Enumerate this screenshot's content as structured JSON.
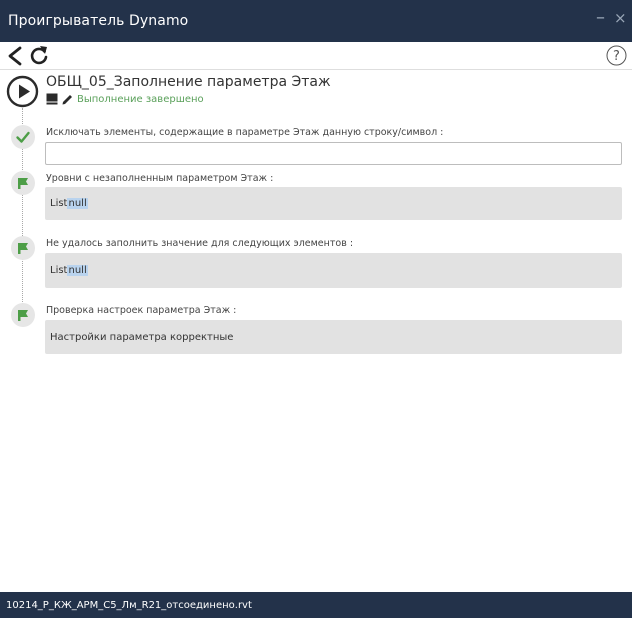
{
  "window": {
    "title": "Проигрыватель Dynamo",
    "minimize_glyph": "–",
    "close_glyph": "×"
  },
  "toolbar": {
    "back_icon": "back-arrow-icon",
    "refresh_icon": "refresh-icon",
    "help_icon": "help-icon",
    "help_glyph": "?"
  },
  "script": {
    "name": "ОБЩ_05_Заполнение параметра Этаж",
    "status": "Выполнение завершено"
  },
  "steps": [
    {
      "icon": "checkmark-icon",
      "label": "Исключать элементы, содержащие в параметре Этаж данную строку/символ :",
      "input_value": ""
    },
    {
      "icon": "flag-icon",
      "label": "Уровни с незаполненным параметром Этаж :",
      "output_prefix": "List",
      "output_value": "null"
    },
    {
      "icon": "flag-icon",
      "label": "Не удалось заполнить значение для следующих элементов :",
      "output_prefix": "List",
      "output_value": "null"
    },
    {
      "icon": "flag-icon",
      "label": "Проверка настроек параметра Этаж :",
      "output_value": "Настройки параметра корректные"
    }
  ],
  "footer": {
    "document_name": "10214_Р_КЖ_АРМ_С5_Лм_R21_отсоединено.rvt"
  },
  "colors": {
    "titlebar": "#23324a",
    "status_green": "#5aa05a",
    "flag_green": "#4d9e47",
    "output_bg": "#e2e2e2",
    "highlight": "#b9d3ee"
  }
}
